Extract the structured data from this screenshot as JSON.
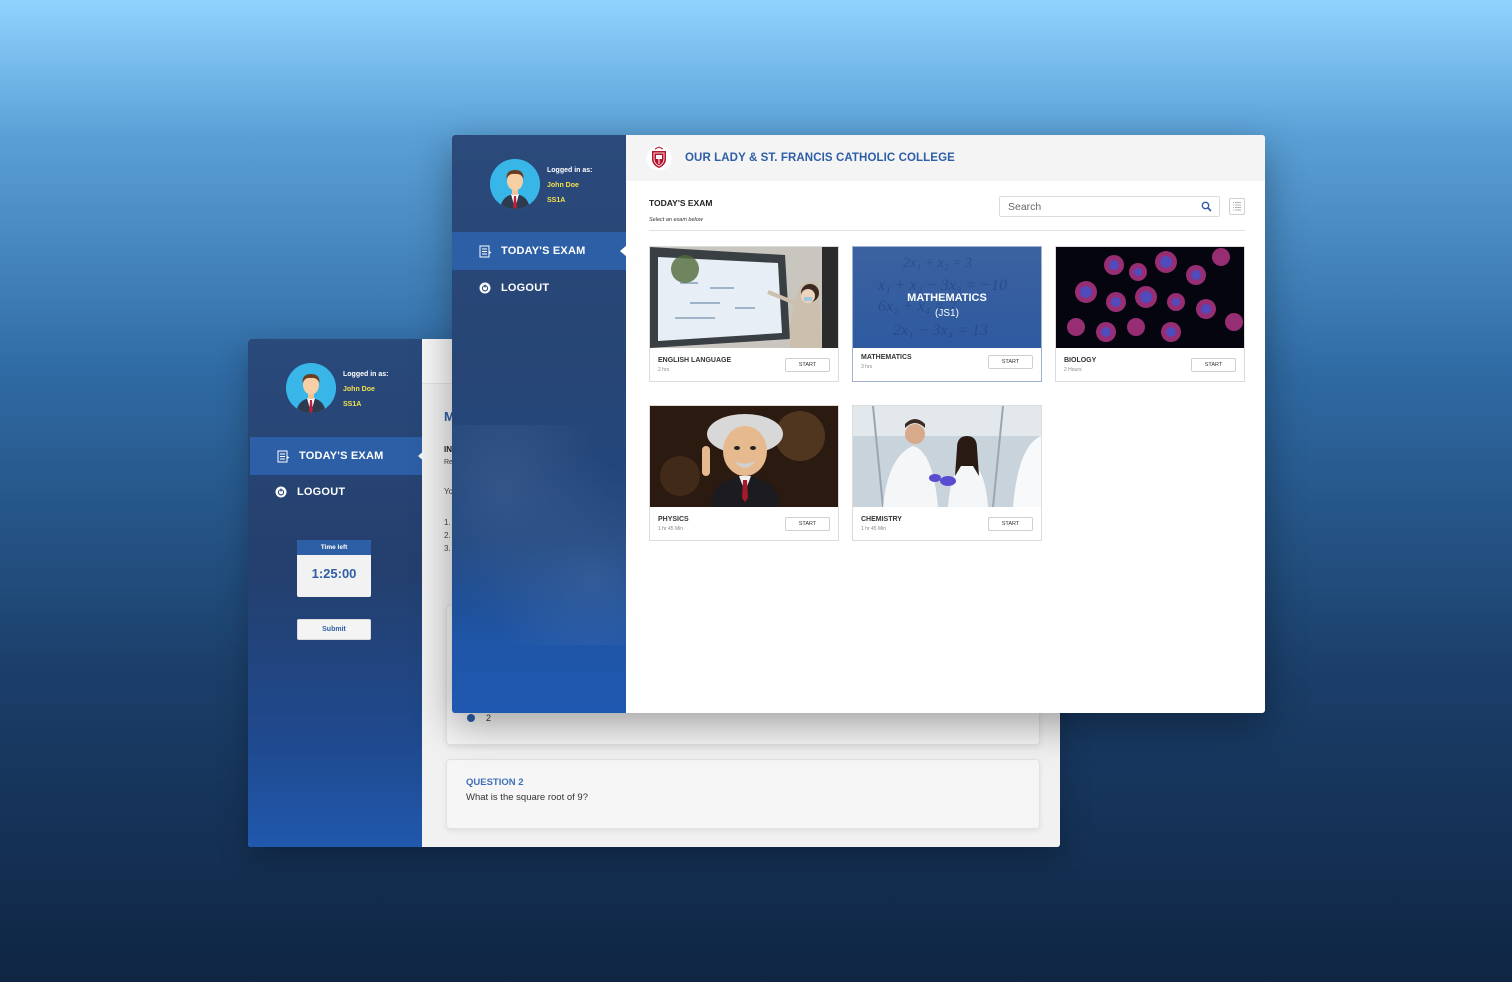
{
  "user": {
    "logged_in_label": "Logged in as:",
    "name": "John Doe",
    "class": "SS1A"
  },
  "nav": {
    "todays_exam": "TODAY'S EXAM",
    "logout": "LOGOUT"
  },
  "school_name": "OUR LADY & ST. FRANCIS CATHOLIC COLLEGE",
  "exam_page": {
    "title": "TODAY'S EXAM",
    "subtitle": "Select an exam below",
    "search_placeholder": "Search",
    "start_label": "START",
    "cards": [
      {
        "title": "ENGLISH LANGUAGE",
        "duration": "2 hrs"
      },
      {
        "title": "MATHEMATICS",
        "duration": "3 hrs",
        "banner_title": "MATHEMATICS",
        "banner_sub": "(JS1)"
      },
      {
        "title": "BIOLOGY",
        "duration": "2 Hours"
      },
      {
        "title": "PHYSICS",
        "duration": "1 hr 45 Min"
      },
      {
        "title": "CHEMISTRY",
        "duration": "1 hr 45 Min"
      }
    ]
  },
  "back_window": {
    "timer_label": "Time left",
    "timer_value": "1:25:00",
    "submit_label": "Submit",
    "partial_heading": "M",
    "partial_in": "IN",
    "partial_re": "Re",
    "partial_yo": "Yo",
    "partial_list": [
      "1.",
      "2.",
      "3."
    ],
    "option_value": "2",
    "question2_label": "QUESTION 2",
    "question2_text": "What is the square root of 9?"
  },
  "colors": {
    "accent": "#2d5ea6",
    "sidebar": "#243f6d",
    "active_nav": "#2c5fa5",
    "name_highlight": "#f5e24b"
  },
  "icons": [
    "exam-list-icon",
    "power-icon",
    "search-icon",
    "list-view-icon",
    "school-crest-icon",
    "avatar-icon"
  ]
}
